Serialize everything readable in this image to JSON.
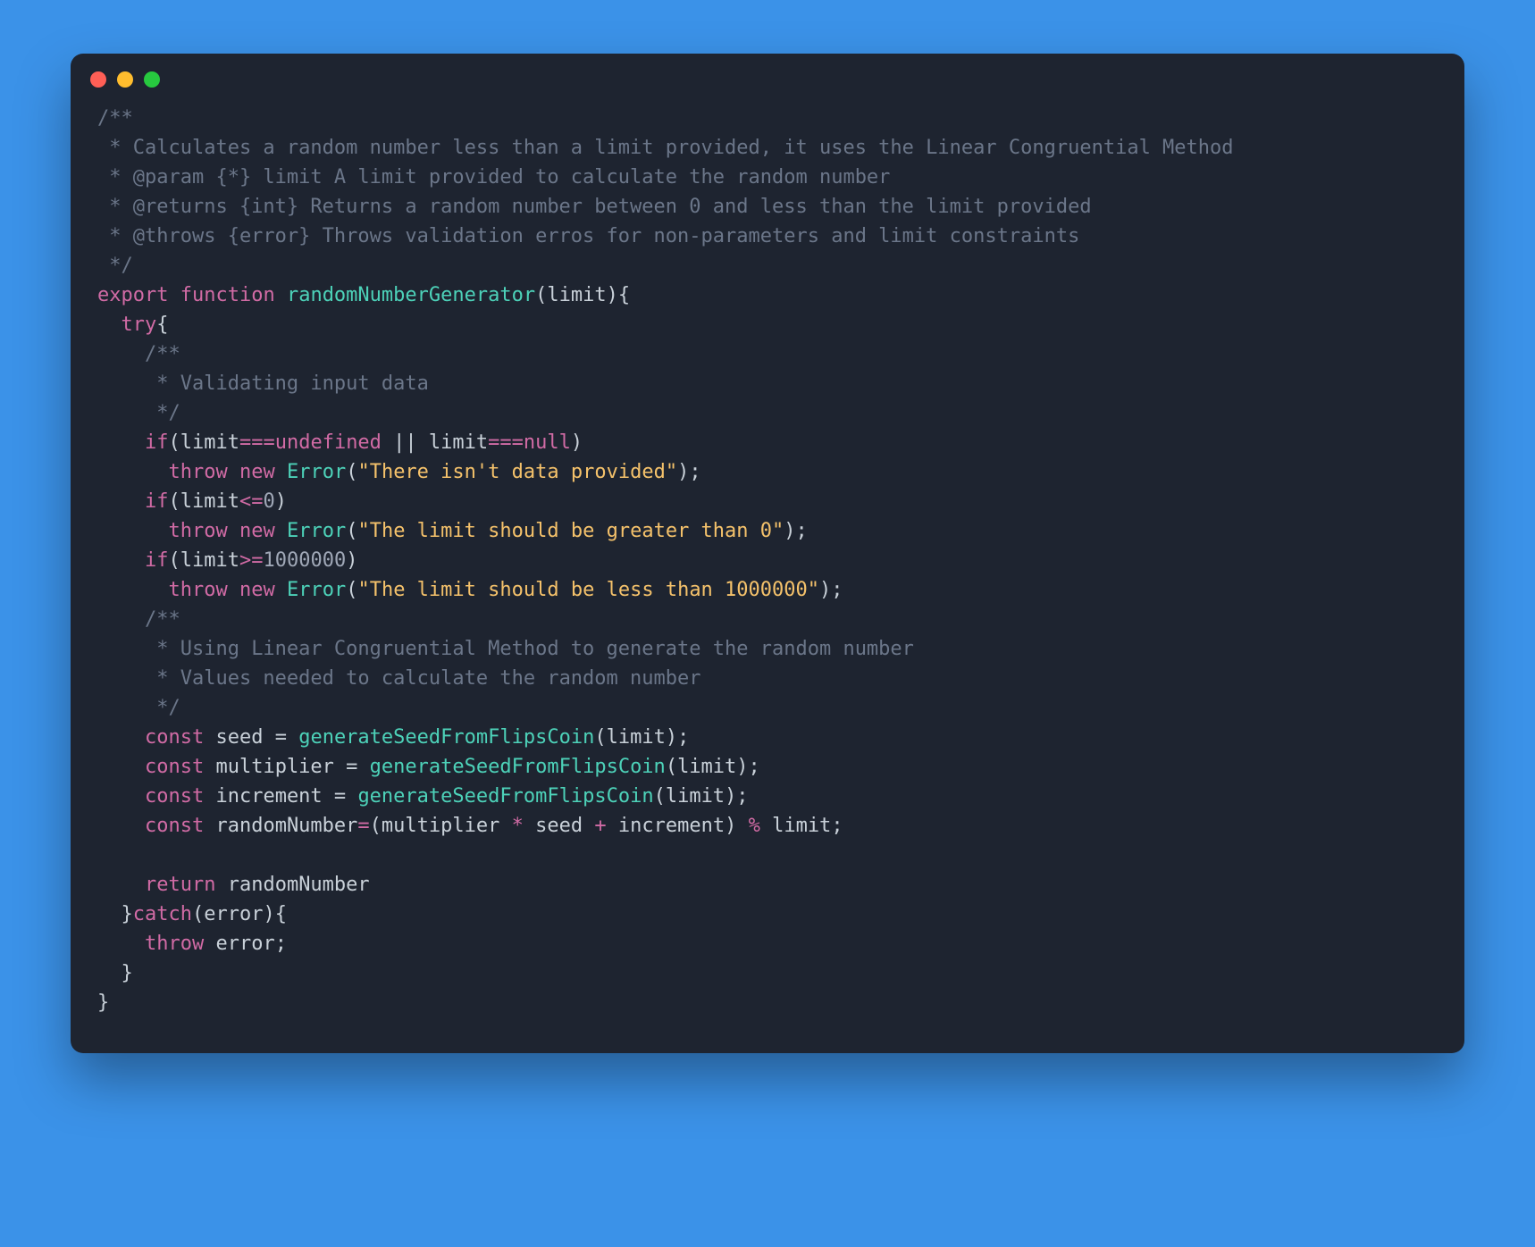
{
  "colors": {
    "background": "#3b92e8",
    "window": "#1e2430",
    "dot_red": "#ff5f56",
    "dot_yellow": "#ffbd2e",
    "dot_green": "#27c93f",
    "comment": "#6b7689",
    "keyword": "#d16ba5",
    "function": "#4dd2b9",
    "string": "#f5c26b"
  },
  "code": {
    "l1": "/**",
    "l2": " * Calculates a random number less than a limit provided, it uses the Linear Congruential Method",
    "l3": " * @param {*} limit A limit provided to calculate the random number",
    "l4": " * @returns {int} Returns a random number between 0 and less than the limit provided",
    "l5": " * @throws {error} Throws validation erros for non-parameters and limit constraints",
    "l6": " */",
    "l7_export": "export",
    "l7_function": "function",
    "l7_name": "randomNumberGenerator",
    "l7_open": "(",
    "l7_param": "limit",
    "l7_close": "){",
    "l8_try": "try",
    "l8_brace": "{",
    "l9": "/**",
    "l10": " * Validating input data",
    "l11": " */",
    "l12_if": "if",
    "l12_open": "(",
    "l12_a": "limit",
    "l12_op1": "===",
    "l12_b": "undefined",
    "l12_or": " || ",
    "l12_c": "limit",
    "l12_op2": "===",
    "l12_d": "null",
    "l12_close": ")",
    "l13_throw": "throw",
    "l13_new": "new",
    "l13_err": "Error",
    "l13_open": "(",
    "l13_str": "\"There isn't data provided\"",
    "l13_close": ");",
    "l14_if": "if",
    "l14_open": "(",
    "l14_a": "limit",
    "l14_op": "<=",
    "l14_num": "0",
    "l14_close": ")",
    "l15_throw": "throw",
    "l15_new": "new",
    "l15_err": "Error",
    "l15_open": "(",
    "l15_str": "\"The limit should be greater than 0\"",
    "l15_close": ");",
    "l16_if": "if",
    "l16_open": "(",
    "l16_a": "limit",
    "l16_op": ">=",
    "l16_num": "1000000",
    "l16_close": ")",
    "l17_throw": "throw",
    "l17_new": "new",
    "l17_err": "Error",
    "l17_open": "(",
    "l17_str": "\"The limit should be less than 1000000\"",
    "l17_close": ");",
    "l18": "/**",
    "l19": " * Using Linear Congruential Method to generate the random number",
    "l20": " * Values needed to calculate the random number",
    "l21": " */",
    "l22_const": "const",
    "l22_name": "seed",
    "l22_eq": " = ",
    "l22_fn": "generateSeedFromFlipsCoin",
    "l22_open": "(",
    "l22_arg": "limit",
    "l22_close": ");",
    "l23_const": "const",
    "l23_name": "multiplier",
    "l23_eq": " = ",
    "l23_fn": "generateSeedFromFlipsCoin",
    "l23_open": "(",
    "l23_arg": "limit",
    "l23_close": ");",
    "l24_const": "const",
    "l24_name": "increment",
    "l24_eq": " = ",
    "l24_fn": "generateSeedFromFlipsCoin",
    "l24_open": "(",
    "l24_arg": "limit",
    "l24_close": ");",
    "l25_const": "const",
    "l25_name": "randomNumber",
    "l25_eq": "=",
    "l25_open": "(",
    "l25_a": "multiplier",
    "l25_op1": " * ",
    "l25_b": "seed",
    "l25_op2": " + ",
    "l25_c": "increment",
    "l25_close": ")",
    "l25_mod": " % ",
    "l25_d": "limit",
    "l25_semi": ";",
    "l26_return": "return",
    "l26_val": "randomNumber",
    "l27_close": "}",
    "l27_catch": "catch",
    "l27_open": "(",
    "l27_param": "error",
    "l27_close2": "){",
    "l28_throw": "throw",
    "l28_val": "error",
    "l28_semi": ";",
    "l29": "}",
    "l30": "}"
  }
}
